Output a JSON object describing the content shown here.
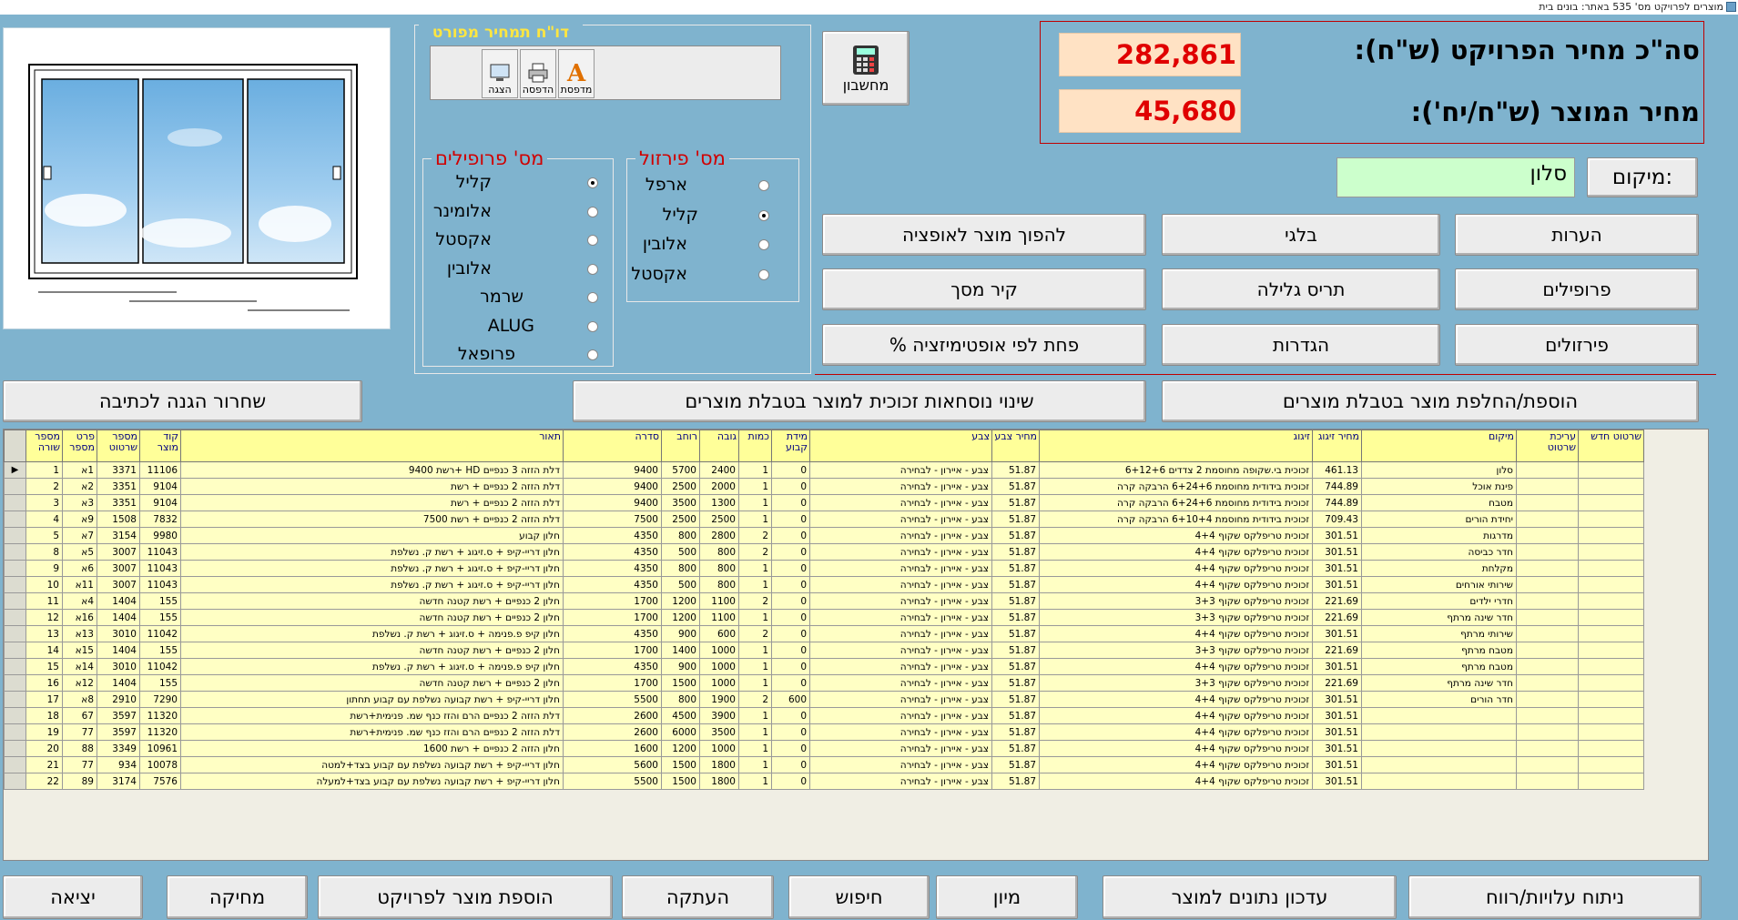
{
  "window": {
    "title": "מוצרים לפרויקט מס' 535  באתר: בונים בית"
  },
  "report": {
    "title": "דו\"ח תמחיר מפורט",
    "preview_label": "הצגה",
    "print_label": "הדפסה",
    "printer_label": "מדפסת"
  },
  "calculator": {
    "label": "מחשבון"
  },
  "profiles": {
    "title": "מס' פרופילים",
    "options": [
      "קליל",
      "אלומינר",
      "אקסטל",
      "אלובין",
      "שרמר",
      "ALUG",
      "פרופאל"
    ],
    "selected_index": 0
  },
  "hardware": {
    "title": "מס' פירזול",
    "options": [
      "ארפל",
      "קליל",
      "אלובין",
      "אקסטל"
    ],
    "selected_index": 1
  },
  "prices": {
    "project_total_label": "סה\"כ מחיר הפרויקט (ש\"ח):",
    "project_total_value": "282,861",
    "product_price_label": "מחיר המוצר (ש\"ח/יח'):",
    "product_price_value": "45,680"
  },
  "location": {
    "label": ":מיקום",
    "value": "סלון"
  },
  "actions": {
    "notes": "הערות",
    "belgian": "בלגי",
    "to_option": "להפוך מוצר לאופציה",
    "profiles": "פרופילים",
    "rolling_shutter": "תריס גלילה",
    "screen_wall": "קיר מסך",
    "hardware": "פירזולים",
    "settings": "הגדרות",
    "waste": "פחת לפי אופטימיזציה %",
    "add_replace": "הוספת/החלפת מוצר בטבלת מוצרים",
    "glass_formulas": "שינוי נוסחאות זכוכית למוצר בטבלת מוצרים",
    "release_protect": "שחרור הגנה לכתיבה"
  },
  "table": {
    "columns": [
      "שרטוט חדש",
      "עריכת שרטוט",
      "מיקום",
      "מחיר זיגוג",
      "זיגוג",
      "מחיר צבע",
      "צבע",
      "מידת קבוע",
      "כמות",
      "גובה",
      "רוחב",
      "סדרה",
      "תאור",
      "קוד מוצר",
      "מספר שרטוט",
      "פרט מספר",
      "מספר שורה"
    ],
    "rows": [
      [
        "",
        "",
        "סלון",
        "461.13",
        "זכוכית בי.שקופה מחוסמת 2 צדדים 6+12+6",
        "51.87",
        "צבע - איירון - לבחירה",
        "0",
        "1",
        "2400",
        "5700",
        "9400",
        "דלת הזזה 3 כנפיים HD +רשת 9400",
        "11106",
        "3371",
        "1א",
        "1"
      ],
      [
        "",
        "",
        "פינת אוכל",
        "744.89",
        "זכוכית בידודית מחוסמת 6+24+6 הרבקה קרה",
        "51.87",
        "צבע - איירון - לבחירה",
        "0",
        "1",
        "2000",
        "2500",
        "9400",
        "דלת הזזה 2 כנפיים + רשת",
        "9104",
        "3351",
        "2א",
        "2"
      ],
      [
        "",
        "",
        "מטבח",
        "744.89",
        "זכוכית בידודית מחוסמת 6+24+6 הרבקה קרה",
        "51.87",
        "צבע - איירון - לבחירה",
        "0",
        "1",
        "1300",
        "3500",
        "9400",
        "דלת הזזה 2 כנפיים + רשת",
        "9104",
        "3351",
        "3א",
        "3"
      ],
      [
        "",
        "",
        "יחידת הורים",
        "709.43",
        "זכוכית בידודית מחוסמת 6+10+4 הרבקה קרה",
        "51.87",
        "צבע - איירון - לבחירה",
        "0",
        "1",
        "2500",
        "2500",
        "7500",
        "דלת הזזה 2 כנפיים + רשת 7500",
        "7832",
        "1508",
        "9א",
        "4"
      ],
      [
        "",
        "",
        "מדרגות",
        "301.51",
        "זכוכית טריפלקס שקוף 4+4",
        "51.87",
        "צבע - איירון - לבחירה",
        "0",
        "2",
        "2800",
        "800",
        "4350",
        "חלון קבוע",
        "9980",
        "3154",
        "7א",
        "5"
      ],
      [
        "",
        "",
        "חדר כביסה",
        "301.51",
        "זכוכית טריפלקס שקוף 4+4",
        "51.87",
        "צבע - איירון - לבחירה",
        "0",
        "2",
        "800",
        "500",
        "4350",
        "חלון דריי-קיפ + ס.זיגוג + רשת ק. נשלפת",
        "11043",
        "3007",
        "5א",
        "8"
      ],
      [
        "",
        "",
        "מקלחת",
        "301.51",
        "זכוכית טריפלקס שקוף 4+4",
        "51.87",
        "צבע - איירון - לבחירה",
        "0",
        "1",
        "800",
        "800",
        "4350",
        "חלון דריי-קיפ + ס.זיגוג + רשת ק. נשלפת",
        "11043",
        "3007",
        "6א",
        "9"
      ],
      [
        "",
        "",
        "שירותי אורחים",
        "301.51",
        "זכוכית טריפלקס שקוף 4+4",
        "51.87",
        "צבע - איירון - לבחירה",
        "0",
        "1",
        "800",
        "500",
        "4350",
        "חלון דריי-קיפ + ס.זיגוג + רשת ק. נשלפת",
        "11043",
        "3007",
        "11א",
        "10"
      ],
      [
        "",
        "",
        "חדרי ילדים",
        "221.69",
        "זכוכית טריפלקס שקוף 3+3",
        "51.87",
        "צבע - איירון - לבחירה",
        "0",
        "2",
        "1100",
        "1200",
        "1700",
        "חלון 2 כנפיים + רשת קטנה חדשה",
        "155",
        "1404",
        "4א",
        "11"
      ],
      [
        "",
        "",
        "חדר שינה מרתף",
        "221.69",
        "זכוכית טריפלקס שקוף 3+3",
        "51.87",
        "צבע - איירון - לבחירה",
        "0",
        "1",
        "1100",
        "1200",
        "1700",
        "חלון 2 כנפיים + רשת קטנה חדשה",
        "155",
        "1404",
        "16א",
        "12"
      ],
      [
        "",
        "",
        "שירותי מרתף",
        "301.51",
        "זכוכית טריפלקס שקוף 4+4",
        "51.87",
        "צבע - איירון - לבחירה",
        "0",
        "2",
        "600",
        "900",
        "4350",
        "חלון קיפ פ.פנימה + ס.זיגוג + רשת ק. נשלפת",
        "11042",
        "3010",
        "13א",
        "13"
      ],
      [
        "",
        "",
        "מטבח מרתף",
        "221.69",
        "זכוכית טריפלקס שקוף 3+3",
        "51.87",
        "צבע - איירון - לבחירה",
        "0",
        "1",
        "1000",
        "1400",
        "1700",
        "חלון 2 כנפיים + רשת קטנה חדשה",
        "155",
        "1404",
        "15א",
        "14"
      ],
      [
        "",
        "",
        "מטבח מרתף",
        "301.51",
        "זכוכית טריפלקס שקוף 4+4",
        "51.87",
        "צבע - איירון - לבחירה",
        "0",
        "1",
        "1000",
        "900",
        "4350",
        "חלון קיפ פ.פנימה + ס.זיגוג + רשת ק. נשלפת",
        "11042",
        "3010",
        "14א",
        "15"
      ],
      [
        "",
        "",
        "חדר שינה מרתף",
        "221.69",
        "זכוכית טריפלקס שקוף 3+3",
        "51.87",
        "צבע - איירון - לבחירה",
        "0",
        "1",
        "1000",
        "1500",
        "1700",
        "חלון 2 כנפיים + רשת קטנה חדשה",
        "155",
        "1404",
        "12א",
        "16"
      ],
      [
        "",
        "",
        "חדר הורים",
        "301.51",
        "זכוכית טריפלקס שקוף 4+4",
        "51.87",
        "צבע - איירון - לבחירה",
        "600",
        "2",
        "1900",
        "800",
        "5500",
        "חלון דריי-קיפ + רשת קבועה נשלפת  עם קבוע תחתון",
        "7290",
        "2910",
        "8א",
        "17"
      ],
      [
        "",
        "",
        "",
        "301.51",
        "זכוכית טריפלקס שקוף 4+4",
        "51.87",
        "צבע - איירון - לבחירה",
        "0",
        "1",
        "3900",
        "4500",
        "2600",
        "דלת הזזה 2 כנפיים הרם והזז כנף שמ. פנימית+רשת",
        "11320",
        "3597",
        "67",
        "18"
      ],
      [
        "",
        "",
        "",
        "301.51",
        "זכוכית טריפלקס שקוף 4+4",
        "51.87",
        "צבע - איירון - לבחירה",
        "0",
        "1",
        "3500",
        "6000",
        "2600",
        "דלת הזזה 2 כנפיים הרם והזז כנף שמ. פנימית+רשת",
        "11320",
        "3597",
        "77",
        "19"
      ],
      [
        "",
        "",
        "",
        "301.51",
        "זכוכית טריפלקס שקוף 4+4",
        "51.87",
        "צבע - איירון - לבחירה",
        "0",
        "1",
        "1000",
        "1200",
        "1600",
        "חלון הזזה 2 כנפיים + רשת 1600",
        "10961",
        "3349",
        "88",
        "20"
      ],
      [
        "",
        "",
        "",
        "301.51",
        "זכוכית טריפלקס שקוף 4+4",
        "51.87",
        "צבע - איירון - לבחירה",
        "0",
        "1",
        "1800",
        "1500",
        "5600",
        "חלון דריי-קיפ + רשת קבועה נשלפת  עם קבוע בצד+למטה",
        "10078",
        "934",
        "77",
        "21"
      ],
      [
        "",
        "",
        "",
        "301.51",
        "זכוכית טריפלקס שקוף 4+4",
        "51.87",
        "צבע - איירון - לבחירה",
        "0",
        "1",
        "1800",
        "1500",
        "5500",
        "חלון דריי-קיפ + רשת קבועה נשלפת  עם קבוע בצד+למעלה",
        "7576",
        "3174",
        "89",
        "22"
      ]
    ]
  },
  "bottom": {
    "cost_analysis": "ניתוח עלויות/רווח",
    "update_data": "עדכון נתונים למוצר",
    "sort": "מיון",
    "search": "חיפוש",
    "copy": "העתקה",
    "add_product": "הוספת מוצר לפרויקט",
    "delete": "מחיקה",
    "exit": "יציאה"
  },
  "colors": {
    "background": "#7FB3CE",
    "accent_red": "#d00000",
    "header_yellow": "#ffff99",
    "row_yellow": "#ffffc4",
    "price_bg": "#ffe2c4",
    "location_bg": "#ccffcc"
  }
}
